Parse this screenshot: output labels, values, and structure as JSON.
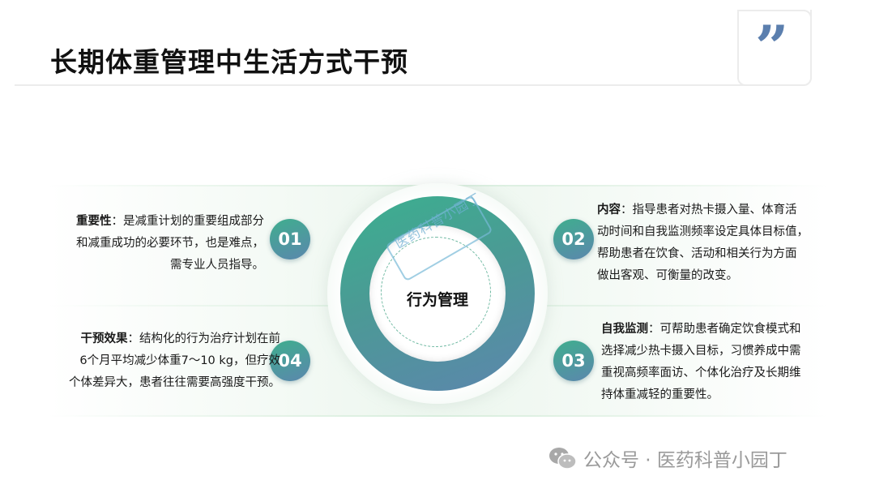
{
  "title": "长期体重管理中生活方式干预",
  "quote_glyph": "”",
  "center_label": "行为管理",
  "watermark_stamp": "医药科普小园丁",
  "badges": [
    "01",
    "02",
    "03",
    "04"
  ],
  "blocks": {
    "b01": {
      "heading": "重要性",
      "lines": [
        "：是减重计划的重要组成部分",
        "和减重成功的必要环节，也是难点，",
        "需专业人员指导。"
      ]
    },
    "b02": {
      "heading": "内容",
      "lines": [
        "：指导患者对热卡摄入量、体育活",
        "动时间和自我监测频率设定具体目标值，",
        "帮助患者在饮食、活动和相关行为方面",
        "做出客观、可衡量的改变。"
      ]
    },
    "b03": {
      "heading": "自我监测",
      "lines": [
        "：可帮助患者确定饮食模式和",
        "选择减少热卡摄入目标，习惯养成中需",
        "重视高频率面访、个体化治疗及长期维",
        "持体重减轻的重要性。"
      ]
    },
    "b04": {
      "heading": "干预效果",
      "lines": [
        "：结构化的行为治疗计划在前",
        "6个月平均减少体重7～10 kg，但疗效",
        "个体差异大，患者往往需要高强度干预。"
      ]
    }
  },
  "footer": {
    "text": "公众号 · 医药科普小园丁",
    "icon": "wechat-icon"
  },
  "colors": {
    "accent_green": "#3bb08f",
    "accent_blue": "#5c86ad",
    "quote": "#5b7fae"
  }
}
